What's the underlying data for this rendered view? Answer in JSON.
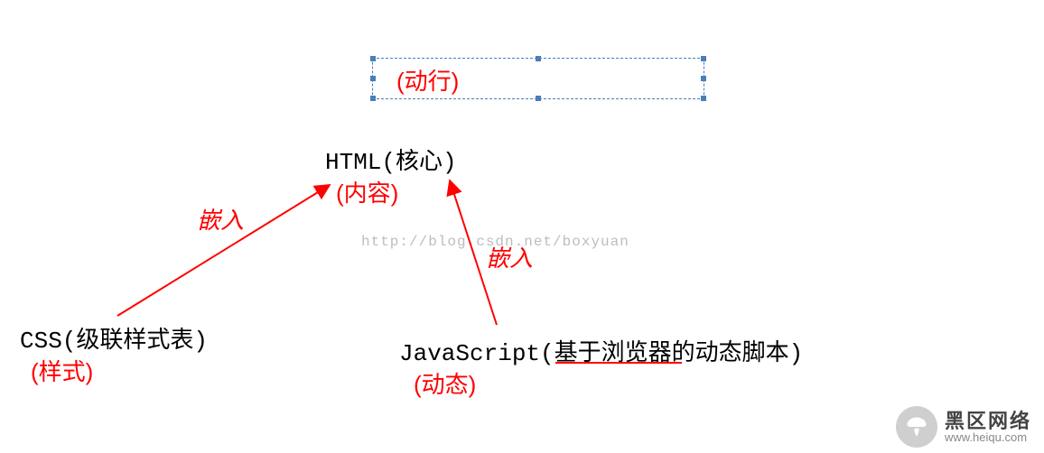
{
  "selected_box": {
    "label": "(动行)"
  },
  "nodes": {
    "html": {
      "title": "HTML(核心)",
      "subtitle": "(内容)"
    },
    "css": {
      "title": "CSS(级联样式表)",
      "subtitle": "(样式)"
    },
    "js": {
      "title": "JavaScript(基于浏览器的动态脚本)",
      "subtitle": "(动态)"
    }
  },
  "arrow_labels": {
    "left": "嵌入",
    "right": "嵌入"
  },
  "watermark": "http://blog.csdn.net/boxyuan",
  "logo": {
    "cn": "黑区网络",
    "en": "www.heiqu.com"
  }
}
